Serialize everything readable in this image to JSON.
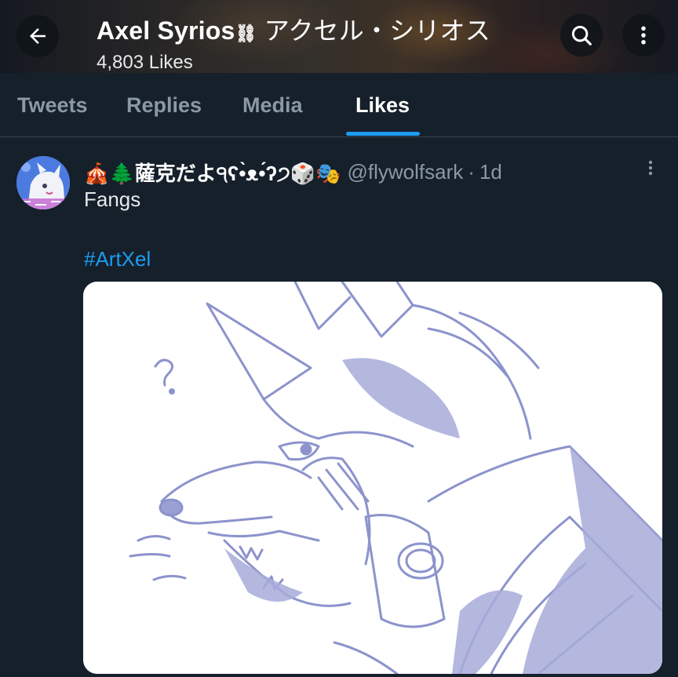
{
  "header": {
    "profile_name": "Axel Syrios",
    "profile_name_symbol": "⛓",
    "profile_name_jp": "アクセル・シリオス",
    "likes_count": "4,803 Likes"
  },
  "icons": {
    "back": "arrow-left-icon",
    "search": "search-icon",
    "more": "more-vertical-icon"
  },
  "tabs": [
    {
      "label": "Tweets",
      "active": false
    },
    {
      "label": "Replies",
      "active": false
    },
    {
      "label": "Media",
      "active": false
    },
    {
      "label": "Likes",
      "active": true
    }
  ],
  "tweet": {
    "display_name": "🎪🌲薩克だよ੧ʕ•̀ᴥ•́ʔ੭🎲🎭",
    "handle": "@flywolfsark",
    "separator": "·",
    "time": "1d",
    "text": "Fangs",
    "hashtag": "#ArtXel"
  },
  "colors": {
    "background": "#15202b",
    "accent": "#1d9bf0",
    "muted": "#8b98a5",
    "sketch_ink": "#8c93cc"
  }
}
